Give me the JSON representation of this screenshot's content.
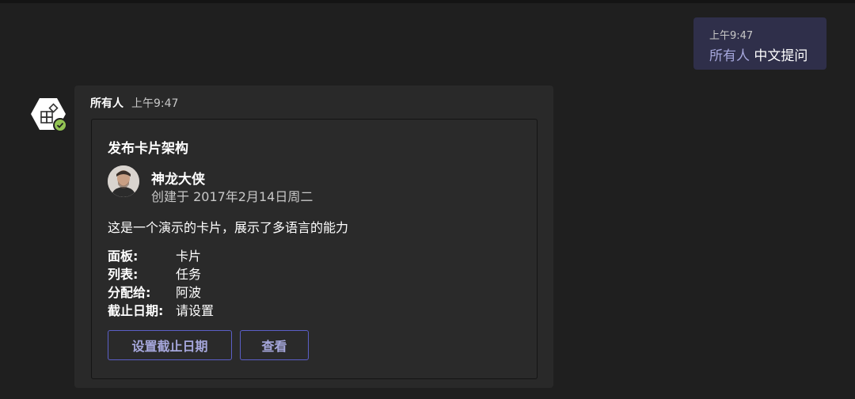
{
  "outgoing_message": {
    "time": "上午9:47",
    "mention": "所有人",
    "text": " 中文提问"
  },
  "incoming_message": {
    "sender": "所有人",
    "time": "上午9:47",
    "avatar_icon": "app-bot-icon",
    "status": "available",
    "card": {
      "title": "发布卡片架构",
      "author_name": "神龙大侠",
      "author_subtitle": "创建于 2017年2月14日周二",
      "body": "这是一个演示的卡片，展示了多语言的能力",
      "facts": [
        {
          "key": "面板:",
          "value": "卡片"
        },
        {
          "key": "列表:",
          "value": "任务"
        },
        {
          "key": "分配给:",
          "value": "阿波"
        },
        {
          "key": "截止日期:",
          "value": "请设置"
        }
      ],
      "actions": {
        "set_due_date": "设置截止日期",
        "view": "查看"
      }
    }
  },
  "colors": {
    "background": "#1f1f1f",
    "outgoing_bubble": "#2f2f4a",
    "mention": "#a6a7dc",
    "button_border": "#5b5fc7",
    "status_available": "#92c353"
  }
}
